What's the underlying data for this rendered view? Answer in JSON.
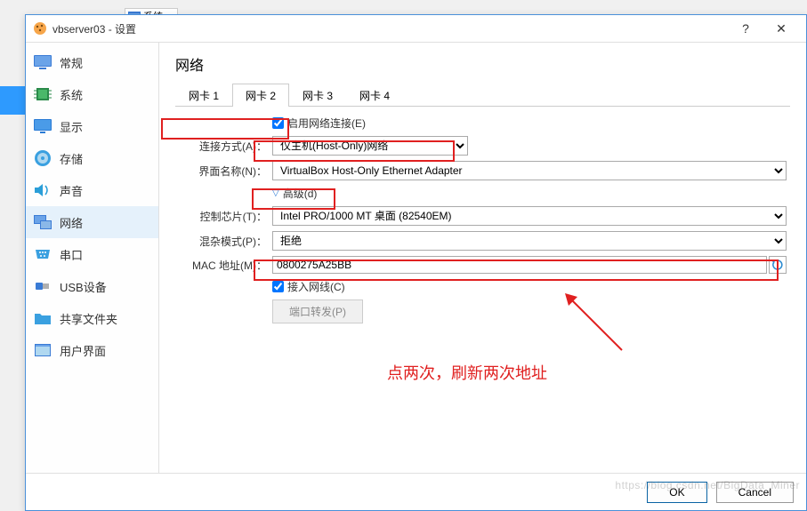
{
  "bg_item": "系统",
  "titlebar": {
    "title": "vbserver03 - 设置"
  },
  "sidebar": {
    "items": [
      {
        "label": "常规"
      },
      {
        "label": "系统"
      },
      {
        "label": "显示"
      },
      {
        "label": "存储"
      },
      {
        "label": "声音"
      },
      {
        "label": "网络"
      },
      {
        "label": "串口"
      },
      {
        "label": "USB设备"
      },
      {
        "label": "共享文件夹"
      },
      {
        "label": "用户界面"
      }
    ]
  },
  "main": {
    "heading": "网络",
    "tabs": [
      {
        "label": "网卡 1"
      },
      {
        "label": "网卡 2"
      },
      {
        "label": "网卡 3"
      },
      {
        "label": "网卡 4"
      }
    ],
    "enable_label": "启用网络连接(E)",
    "attach_label": "连接方式(A)：",
    "attach_value": "仅主机(Host-Only)网络",
    "ifname_label": "界面名称(N)：",
    "ifname_value": "VirtualBox Host-Only Ethernet Adapter",
    "adv_label": "高级(d)",
    "chip_label": "控制芯片(T)：",
    "chip_value": "Intel PRO/1000 MT 桌面 (82540EM)",
    "promisc_label": "混杂模式(P)：",
    "promisc_value": "拒绝",
    "mac_label": "MAC 地址(M)：",
    "mac_value": "0800275A25BB",
    "cable_label": "接入网线(C)",
    "port_label": "端口转发(P)"
  },
  "footer": {
    "ok": "OK",
    "cancel": "Cancel"
  },
  "annotation": {
    "hint": "点两次，刷新两次地址"
  },
  "watermark": "https://blog.csdn.net/BigData_Miner"
}
